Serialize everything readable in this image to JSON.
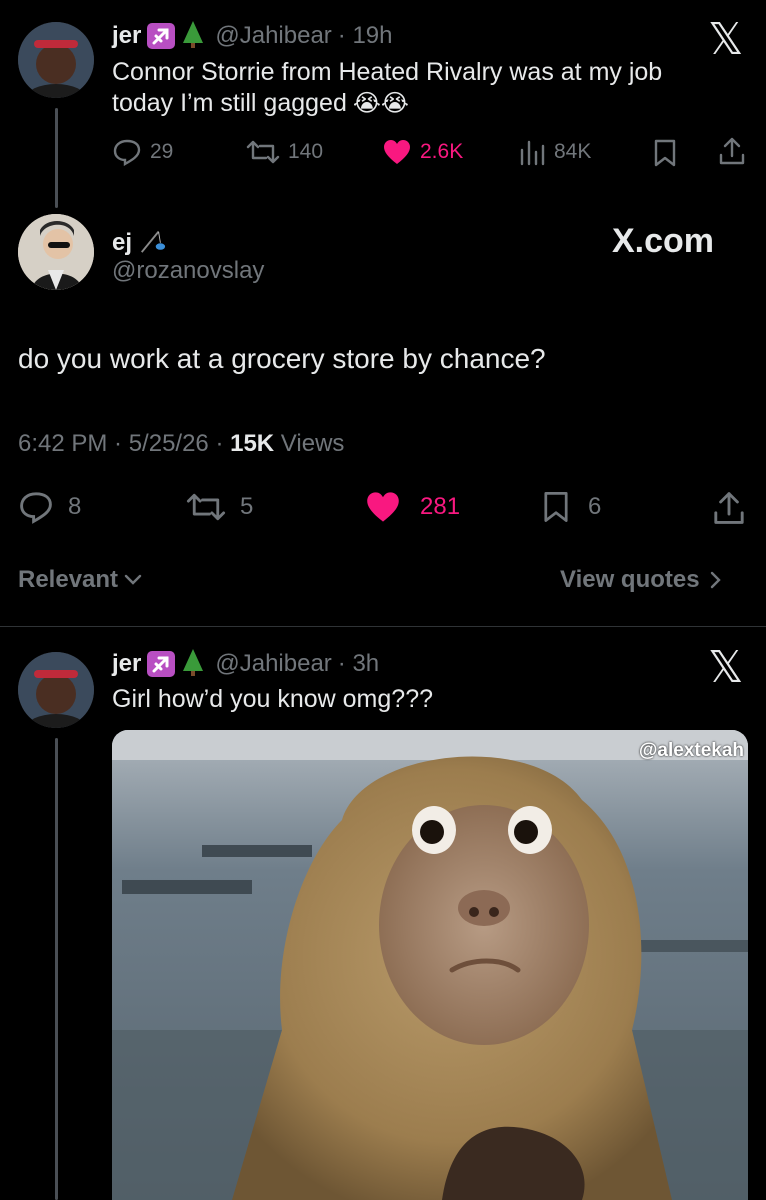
{
  "tweet1": {
    "name": "jer",
    "handle": "@Jahibear",
    "time": "· 19h",
    "text_line1": "Connor Storrie from Heated Rivalry was at my job",
    "text_line2": "today I’m still gagged",
    "emoji": "😭😭",
    "replies": "29",
    "reposts": "140",
    "likes": "2.6K",
    "views": "84K",
    "more_icon": "x-logo-icon"
  },
  "tweet2": {
    "name": "ej",
    "handle": "@rozanovslay",
    "site_label": "X.com",
    "text": "do you work at a grocery store by chance?",
    "timestamp": "6:42 PM · 5/25/26 · ",
    "views_count": "15K",
    "views_label": " Views",
    "replies": "8",
    "reposts": "5",
    "likes": "281",
    "bookmarks": "6",
    "relevant_label": "Relevant",
    "view_quotes_label": "View quotes"
  },
  "tweet3": {
    "name": "jer",
    "handle": "@Jahibear",
    "time": "· 3h",
    "text": "Girl how’d you know omg???",
    "media_watermark": "@alextekah"
  },
  "colors": {
    "like": "#f91880",
    "muted": "#71767b",
    "text": "#e7e9ea",
    "background": "#000000",
    "badge": "#b84fc2"
  }
}
